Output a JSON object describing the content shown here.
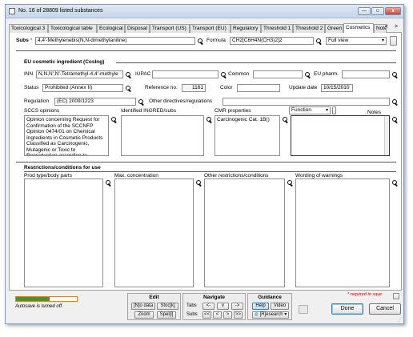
{
  "window": {
    "title": "No. 16 of 28809 listed substances",
    "controls": {
      "minimize": "—",
      "maximize": "□",
      "close": "x"
    }
  },
  "tabs": [
    "Toxicological 3",
    "Toxicological table",
    "Ecological",
    "Disposal",
    "Transport (US)",
    "Transport (EU)",
    "Regulatory",
    "Threshold 1",
    "Threshold 2",
    "Green",
    "Cosmetics",
    "Note"
  ],
  "active_tab": "Cosmetics",
  "tab_arrows": "< >",
  "header": {
    "subs_label": "Subs",
    "required_mark": "*",
    "subs_value": "4,4'-Methylenebis(N,N-dimethylaniline)",
    "formula_label": "Formula",
    "formula_value": "CH2[C6H4N(CH3)2]2",
    "view_value": "Full view"
  },
  "eu_section": {
    "title": "EU cosmetic ingredient (CosIng)",
    "inn_label": "INN",
    "inn_value": "N,N,N',N'-Tetramethyl-4,4'-methyle",
    "iupac_label": "IUPAC",
    "iupac_value": "",
    "common_label": "Common",
    "common_value": "",
    "eupharm_label": "EU pharm.",
    "eupharm_value": "",
    "status_label": "Status",
    "status_value": "Prohibited (Annex II)",
    "refno_label": "Reference no.",
    "refno_value": "1161",
    "color_label": "Color",
    "color_value": "",
    "update_label": "Update date",
    "update_value": "10/15/2010",
    "regulation_label": "Regulation",
    "regulation_value": "(EC) 2009/1223",
    "other_dir_label": "Other directives/regulations",
    "other_dir_value": "",
    "sccs_label": "SCCS opinions",
    "sccs_text": "Opinion concerning Request for Confirmation of the SCCNFP Opinion 0474/01 on Chemical Ingredients in Cosmetic Products Classified as Carcinogenic, Mutagenic or Toxic to Reproduction according to...",
    "ingred_label": "Identified INGRED/subs",
    "ingred_text": "",
    "cmr_label": "CMR properties",
    "cmr_text": "Carcinogenic Cat. 1B()",
    "function_label": "Function",
    "notes_label": "Notes",
    "notes_text": ""
  },
  "restrictions": {
    "title": "Restrictions/conditions for use",
    "columns": [
      "Prod type/body parts",
      "Max. concentration",
      "Other restrictions/conditions",
      "Wording of warnings"
    ]
  },
  "footer": {
    "progress": 0.55,
    "autosave_text": "Autosave is turned off.",
    "edit": {
      "title": "Edit",
      "buttons": [
        "[N]o data",
        "Stoc[k]",
        "Zoom",
        "Spel[l]"
      ]
    },
    "navigate": {
      "title": "Navigate",
      "tabs_label": "Tabs",
      "subs_label": "Subs",
      "tab_buttons": [
        "<-",
        "v",
        "->"
      ],
      "subs_buttons": [
        "<<",
        "<",
        ">",
        ">>"
      ]
    },
    "guidance": {
      "title": "Guidance",
      "help": "Help",
      "video": "Video",
      "research": "[R]esearch"
    },
    "required_note": "* required to save",
    "done": "Done",
    "cancel": "Cancel"
  },
  "colors": {
    "accent": "#3c7fb1",
    "required": "#cc0000",
    "progress_fill": "#2fa02f",
    "progress_border": "#e08030"
  }
}
